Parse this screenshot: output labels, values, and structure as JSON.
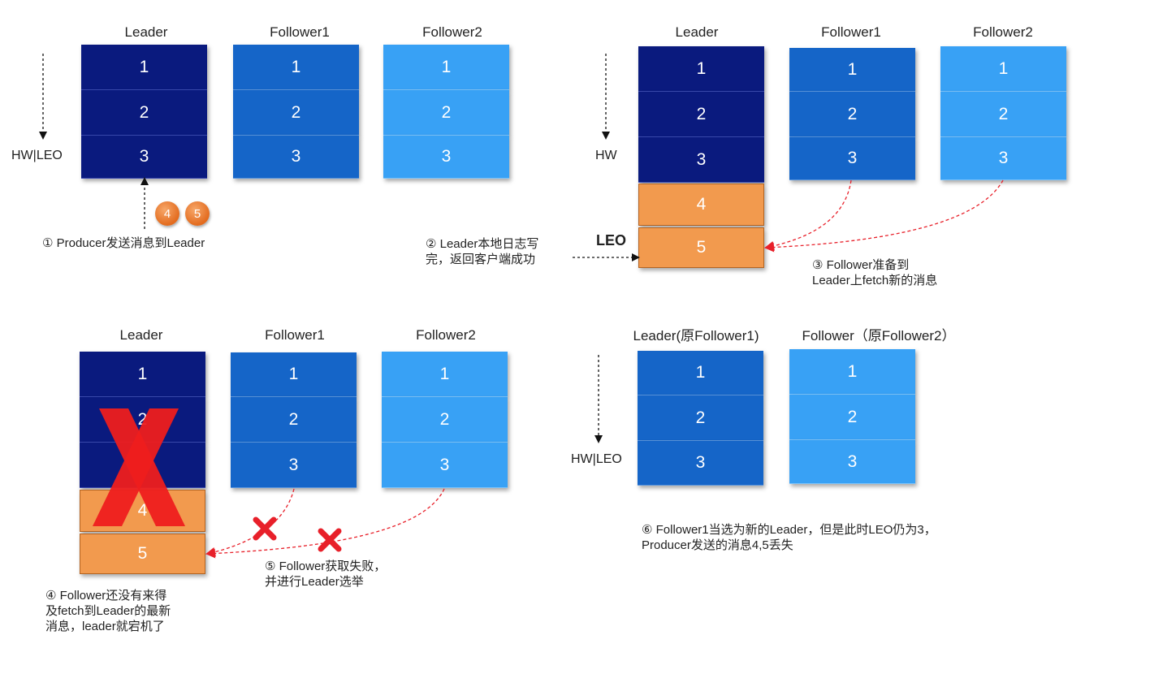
{
  "panel1": {
    "titles": [
      "Leader",
      "Follower1",
      "Follower2"
    ],
    "leader": [
      "1",
      "2",
      "3"
    ],
    "follower1": [
      "1",
      "2",
      "3"
    ],
    "follower2": [
      "1",
      "2",
      "3"
    ],
    "hw_leo": "HW|LEO",
    "bubbles": [
      "4",
      "5"
    ],
    "note": "① Producer发送消息到Leader"
  },
  "panel2": {
    "titles": [
      "Leader",
      "Follower1",
      "Follower2"
    ],
    "leader": [
      "1",
      "2",
      "3"
    ],
    "leader_new": [
      "4",
      "5"
    ],
    "follower1": [
      "1",
      "2",
      "3"
    ],
    "follower2": [
      "1",
      "2",
      "3"
    ],
    "hw": "HW",
    "leo": "LEO",
    "note_left": "② Leader本地日志写\n完，返回客户端成功",
    "note_right": "③ Follower准备到\nLeader上fetch新的消息"
  },
  "panel3": {
    "titles": [
      "Leader",
      "Follower1",
      "Follower2"
    ],
    "leader": [
      "1",
      "2",
      "",
      "4",
      "5"
    ],
    "follower1": [
      "1",
      "2",
      "3"
    ],
    "follower2": [
      "1",
      "2",
      "3"
    ],
    "note_left": "④ Follower还没有来得\n及fetch到Leader的最新\n消息，leader就宕机了",
    "note_mid": "⑤ Follower获取失败，\n并进行Leader选举"
  },
  "panel4": {
    "titles": [
      "Leader(原Follower1)",
      "Follower（原Follower2）"
    ],
    "leader": [
      "1",
      "2",
      "3"
    ],
    "follower": [
      "1",
      "2",
      "3"
    ],
    "hw_leo": "HW|LEO",
    "note": "⑥ Follower1当选为新的Leader，但是此时LEO仍为3，\nProducer发送的消息4,5丢失"
  },
  "colors": {
    "leader_dark": "#0a1a7e",
    "follower_mid": "#1565c8",
    "follower_light": "#38a1f5",
    "uncommitted_orange": "#f29a4e",
    "red_arrow": "#e8202a"
  }
}
